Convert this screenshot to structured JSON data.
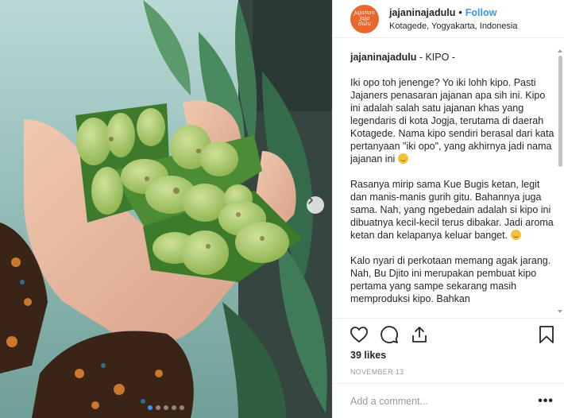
{
  "post": {
    "username": "jajaninajadulu",
    "avatar_text": [
      "jajanan",
      "jaja",
      "dulu"
    ],
    "follow_label": "Follow",
    "separator": "•",
    "location": "Kotagede, Yogyakarta, Indonesia"
  },
  "caption": {
    "username": "jajaninajadulu",
    "title": " - KIPO -",
    "paragraphs": [
      "Iki opo toh jenenge? Yo iki lohh kipo. Pasti Jajaners penasaran jajanan apa sih ini. Kipo ini adalah salah satu jajanan khas yang legendaris di kota Jogja, terutama di daerah Kotagede. Nama kipo sendiri berasal dari kata pertanyaan \"iki opo\", yang akhirnya jadi nama jajanan ini",
      "Rasanya mirip sama Kue Bugis ketan, legit dan manis-manis gurih gitu. Bahannya juga sama. Nah, yang ngebedain adalah si kipo ini dibuatnya kecil-kecil terus dibakar. Jadi aroma ketan dan kelapanya keluar banget.",
      "Kalo nyari di perkotaan memang agak jarang. Nah, Bu Djito ini merupakan pembuat kipo pertama yang sampe sekarang masih memproduksi kipo. Bahkan"
    ]
  },
  "engagement": {
    "likes": "39 likes",
    "date": "NOVEMBER 13"
  },
  "comment": {
    "placeholder": "Add a comment...",
    "more_label": "•••"
  },
  "carousel": {
    "count": 5,
    "active": 0
  },
  "icons": {
    "like": "heart-icon",
    "comment": "comment-icon",
    "share": "share-icon",
    "save": "bookmark-icon",
    "next": "chevron-right-icon"
  },
  "colors": {
    "accent": "#3897f0",
    "avatar_bg": "#e8672a",
    "text": "#262626",
    "muted": "#999999"
  }
}
